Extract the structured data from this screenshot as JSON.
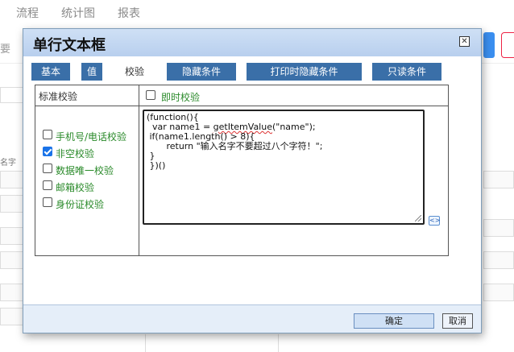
{
  "background": {
    "nav": [
      "流程",
      "统计图",
      "报表"
    ],
    "left_label": "要",
    "field_label": "名字"
  },
  "dialog": {
    "title": "单行文本框",
    "close_symbol": "✕",
    "tabs": [
      {
        "label": "基本",
        "active": false
      },
      {
        "label": "值",
        "active": false
      },
      {
        "label": "校验",
        "active": true
      },
      {
        "label": "隐藏条件",
        "active": false
      },
      {
        "label": "打印时隐藏条件",
        "active": false
      },
      {
        "label": "只读条件",
        "active": false
      }
    ],
    "standard_label": "标准校验",
    "instant": {
      "label": "即时校验",
      "checked": false
    },
    "validations": [
      {
        "label": "手机号/电话校验",
        "checked": false
      },
      {
        "label": "非空校验",
        "checked": true
      },
      {
        "label": "数据唯一校验",
        "checked": false
      },
      {
        "label": "邮箱校验",
        "checked": false
      },
      {
        "label": "身份证校验",
        "checked": false
      }
    ],
    "code": {
      "line1": "(function(){",
      "line2_pre": "  var name1 = ",
      "line2_fn": "getItemValue",
      "line2_post": "(\"name\");",
      "line3": " if(name1.length() > 8){",
      "line4": "       return \"输入名字不要超过八个字符！\";",
      "line5": " }",
      "line6": " })()"
    },
    "ok_label": "确定",
    "cancel_label": "取消"
  }
}
